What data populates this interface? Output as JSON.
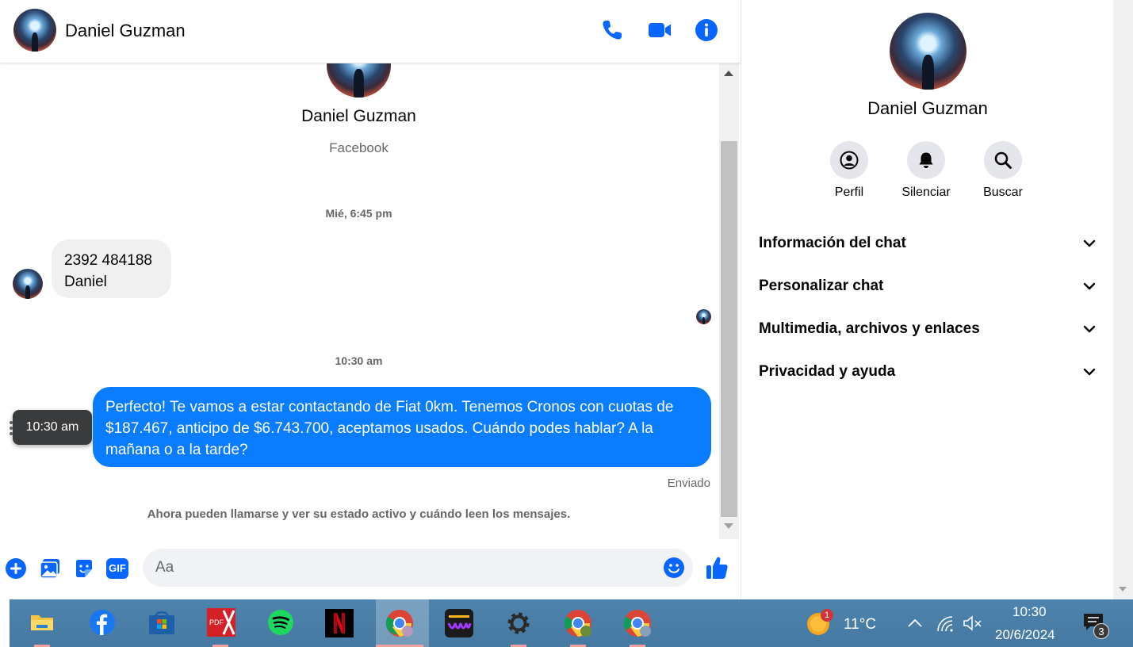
{
  "header": {
    "contact_name": "Daniel Guzman",
    "icons": [
      "phone-icon",
      "video-camera-icon",
      "info-icon"
    ]
  },
  "conversation": {
    "profile_name": "Daniel Guzman",
    "profile_source": "Facebook",
    "separator_1": "Mié, 6:45 pm",
    "incoming_lines": [
      "2392 484188",
      "Daniel"
    ],
    "separator_2": "10:30 am",
    "tooltip_time": "10:30 am",
    "outgoing_message": "Perfecto! Te vamos a estar contactando de Fiat 0km. Tenemos Cronos con cuotas de $187.467, anticipo de $6.743.700, aceptamos usados. Cuándo podes hablar? A la mañana o a la tarde?",
    "status": "Enviado",
    "notice": "Ahora pueden llamarse y ver su estado activo y cuándo leen los mensajes."
  },
  "composer": {
    "placeholder": "Aa",
    "icons": [
      "plus-icon",
      "image-icon",
      "sticker-icon",
      "gif-icon",
      "emoji-icon",
      "thumbs-up-icon"
    ],
    "gif_label": "GIF"
  },
  "right_panel": {
    "name": "Daniel Guzman",
    "actions": [
      {
        "label": "Perfil",
        "icon": "profile-icon"
      },
      {
        "label": "Silenciar",
        "icon": "bell-icon"
      },
      {
        "label": "Buscar",
        "icon": "search-icon"
      }
    ],
    "sections": [
      "Información del chat",
      "Personalizar chat",
      "Multimedia, archivos y enlaces",
      "Privacidad y ayuda"
    ]
  },
  "taskbar": {
    "apps": [
      "file-explorer",
      "facebook",
      "microsoft-store",
      "pdf-editor",
      "spotify",
      "netflix",
      "chrome",
      "deezer",
      "settings",
      "chrome-2",
      "chrome-3"
    ],
    "weather_badge": "1",
    "temperature": "11°C",
    "time": "10:30",
    "date": "20/6/2024",
    "notification_count": "3"
  },
  "colors": {
    "messenger_blue": "#0a7cff",
    "icon_blue": "#0866ff",
    "bubble_gray": "#f0f0f0",
    "taskbar": "#4a7fa8"
  }
}
